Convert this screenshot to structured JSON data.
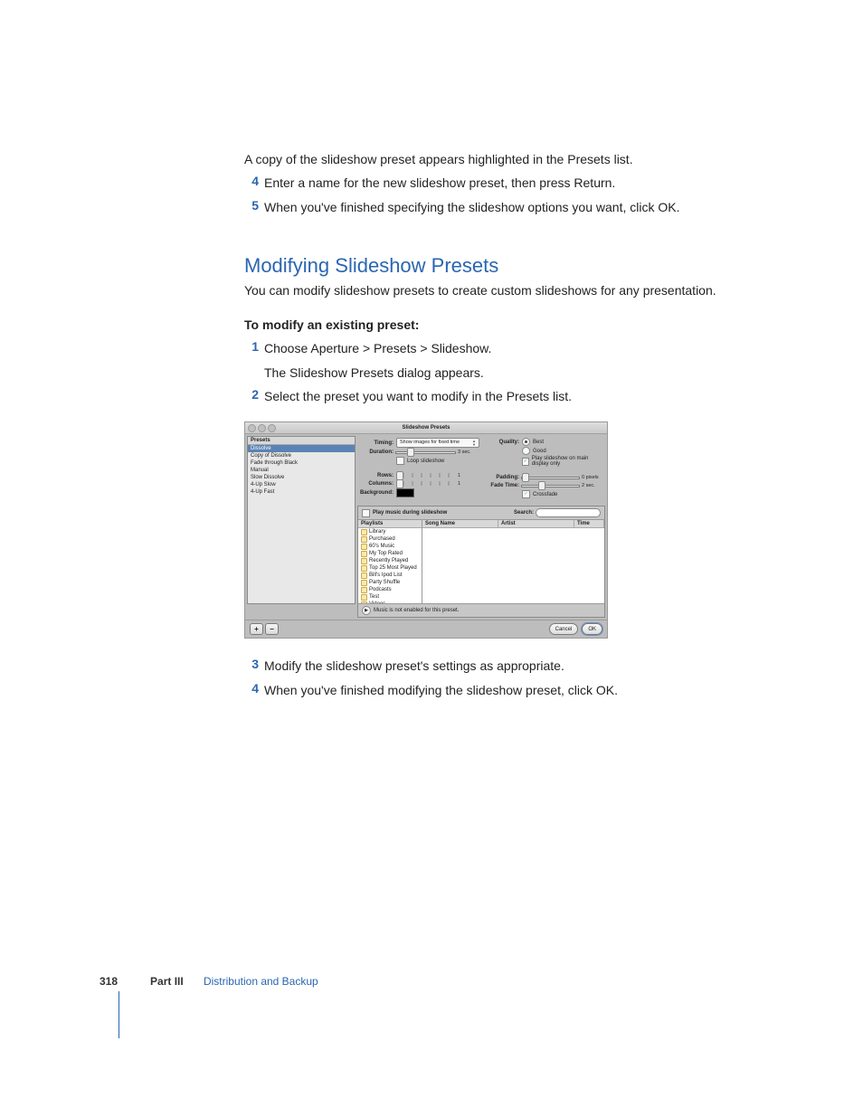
{
  "intro": "A copy of the slideshow preset appears highlighted in the Presets list.",
  "steps_a": [
    {
      "n": "4",
      "t": "Enter a name for the new slideshow preset, then press Return."
    },
    {
      "n": "5",
      "t": "When you've finished specifying the slideshow options you want, click OK."
    }
  ],
  "heading": "Modifying Slideshow Presets",
  "heading_sub": "You can modify slideshow presets to create custom slideshows for any presentation.",
  "subhead": "To modify an existing preset:",
  "steps_b": [
    {
      "n": "1",
      "t": "Choose Aperture > Presets > Slideshow.",
      "after": "The Slideshow Presets dialog appears."
    },
    {
      "n": "2",
      "t": "Select the preset you want to modify in the Presets list."
    }
  ],
  "steps_c": [
    {
      "n": "3",
      "t": "Modify the slideshow preset's settings as appropriate."
    },
    {
      "n": "4",
      "t": "When you've finished modifying the slideshow preset, click OK."
    }
  ],
  "dialog": {
    "title": "Slideshow Presets",
    "preset_header": "Presets",
    "presets": [
      "Dissolve",
      "Copy of Dissolve",
      "Fade through Black",
      "Manual",
      "Slow Dissolve",
      "4-Up Slow",
      "4-Up Fast"
    ],
    "selected_index": 0,
    "labels": {
      "timing": "Timing:",
      "duration": "Duration:",
      "loop": "Loop slideshow",
      "rows": "Rows:",
      "columns": "Columns:",
      "background": "Background:",
      "quality": "Quality:",
      "best": "Best",
      "good": "Good",
      "play_main": "Play slideshow on main display only",
      "padding": "Padding:",
      "fadetime": "Fade Time:",
      "crossfade": "Crossfade"
    },
    "timing_value": "Show images for fixed time",
    "duration_val": "3 sec.",
    "padding_val": "0 pixels",
    "fade_val": "2 sec.",
    "rows_val": "1",
    "cols_val": "1",
    "play_music": "Play music during slideshow",
    "search": "Search:",
    "playlists_header": "Playlists",
    "playlists": [
      "Library",
      "Purchased",
      "60's Music",
      "My Top Rated",
      "Recently Played",
      "Top 25 Most Played",
      "Bill's Ipod List",
      "Party Shuffle",
      "Podcasts",
      "Test",
      "Videos"
    ],
    "songcols": {
      "name": "Song Name",
      "artist": "Artist",
      "time": "Time"
    },
    "music_note": "Music is not enabled for this preset.",
    "add": "+",
    "remove": "−",
    "cancel": "Cancel",
    "ok": "OK"
  },
  "footer": {
    "page": "318",
    "part": "Part III",
    "section": "Distribution and Backup"
  }
}
